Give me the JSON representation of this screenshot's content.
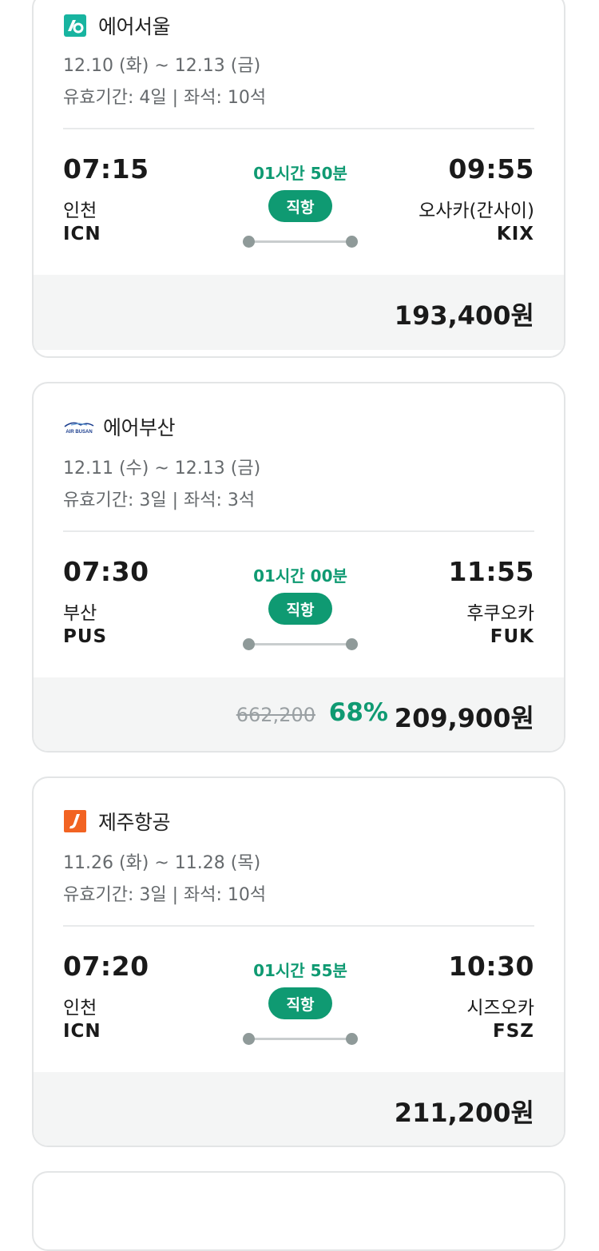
{
  "cards": [
    {
      "airline": "에어서울",
      "logo": "airseoul-logo",
      "dates": "12.10 (화) ~ 12.13 (금)",
      "meta": "유효기간: 4일 | 좌석: 10석",
      "dep_time": "07:15",
      "dep_city": "인천",
      "dep_code": "ICN",
      "duration": "01시간 50분",
      "badge": "직항",
      "arr_time": "09:55",
      "arr_city": "오사카(간사이)",
      "arr_code": "KIX",
      "price": "193,400원"
    },
    {
      "airline": "에어부산",
      "logo": "airbusan-logo",
      "logo_text": "AIR BUSAN",
      "dates": "12.11 (수) ~ 12.13 (금)",
      "meta": "유효기간: 3일 | 좌석: 3석",
      "dep_time": "07:30",
      "dep_city": "부산",
      "dep_code": "PUS",
      "duration": "01시간 00분",
      "badge": "직항",
      "arr_time": "11:55",
      "arr_city": "후쿠오카",
      "arr_code": "FUK",
      "original_price": "662,200",
      "discount": "68%",
      "price": "209,900원"
    },
    {
      "airline": "제주항공",
      "logo": "jejuair-logo",
      "dates": "11.26 (화) ~ 11.28 (목)",
      "meta": "유효기간: 3일 | 좌석: 10석",
      "dep_time": "07:20",
      "dep_city": "인천",
      "dep_code": "ICN",
      "duration": "01시간 55분",
      "badge": "직항",
      "arr_time": "10:30",
      "arr_city": "시즈오카",
      "arr_code": "FSZ",
      "price": "211,200원"
    }
  ],
  "colors": {
    "accent": "#0f9a72",
    "card_border": "#e3e5e6",
    "price_bg": "#f4f5f5",
    "jeju": "#f26322"
  }
}
